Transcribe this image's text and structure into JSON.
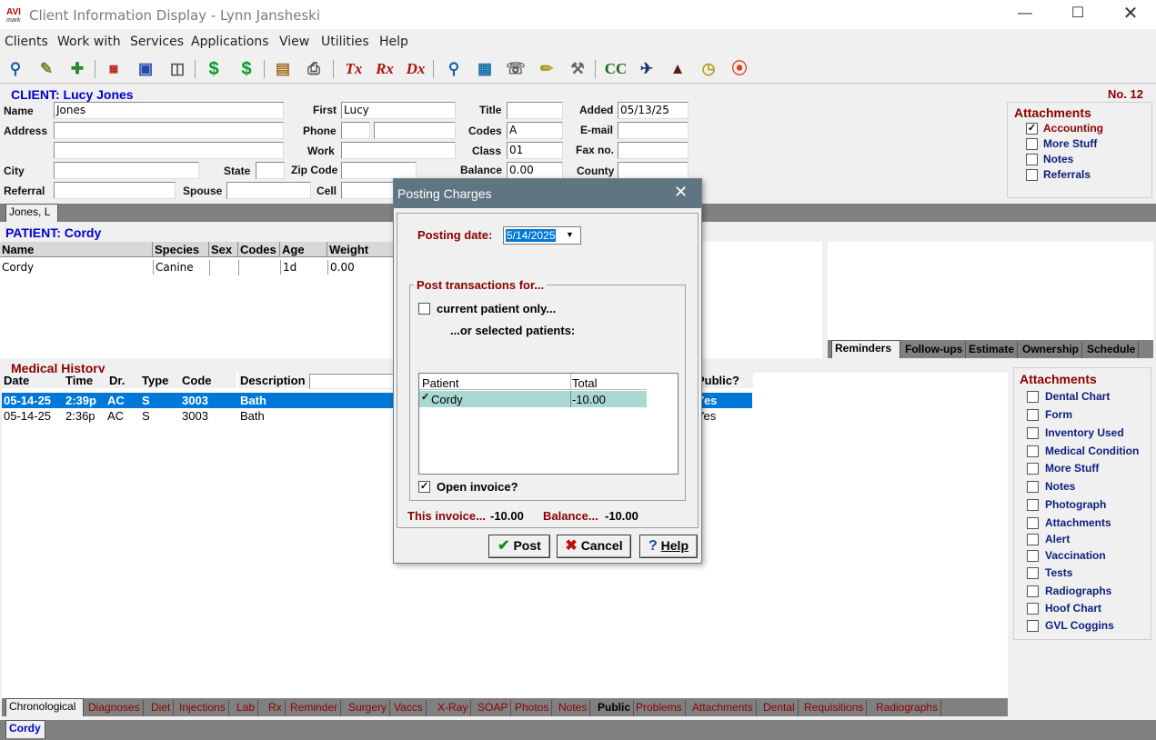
{
  "window": {
    "title": "Client Information Display - Lynn Jansheski",
    "logo_text": "AVImark"
  },
  "menu": [
    "Clients",
    "Work with",
    "Services",
    "Applications",
    "View",
    "Utilities",
    "Help"
  ],
  "toolbar_icons": [
    "search-icon",
    "edit-icon",
    "new-document-icon",
    "calendar-icon",
    "box-icon",
    "monitor-icon",
    "dollar-icon",
    "dollar-plus-icon",
    "clipboard-icon",
    "printer-icon",
    "tx-icon",
    "rx-icon",
    "dx-icon",
    "magnifier-icon",
    "calculator-icon",
    "phone-icon",
    "pencil-icon",
    "wrench-icon",
    "cc-icon",
    "airplane-icon",
    "graduation-cap-icon",
    "timer-icon",
    "lifebuoy-icon"
  ],
  "client": {
    "header": "CLIENT:  Lucy Jones",
    "number": "No. 12",
    "labels": {
      "name": "Name",
      "address": "Address",
      "city": "City",
      "state": "State",
      "zip": "Zip Code",
      "referral": "Referral",
      "spouse": "Spouse",
      "first": "First",
      "phone": "Phone",
      "work": "Work",
      "cell": "Cell",
      "title": "Title",
      "codes": "Codes",
      "class": "Class",
      "balance": "Balance",
      "added": "Added",
      "email": "E-mail",
      "fax": "Fax no.",
      "county": "County"
    },
    "values": {
      "name": "Jones",
      "first": "Lucy",
      "codes": "A",
      "class": "01",
      "balance": "0.00",
      "added": "05/13/25"
    },
    "tab": "Jones, L"
  },
  "client_attachments": {
    "title": "Attachments",
    "items": [
      {
        "label": "Accounting",
        "checked": true
      },
      {
        "label": "More Stuff",
        "checked": false
      },
      {
        "label": "Notes",
        "checked": false
      },
      {
        "label": "Referrals",
        "checked": false
      }
    ]
  },
  "patient": {
    "header": "PATIENT:  Cordy",
    "columns": [
      "Name",
      "Species",
      "Sex",
      "Codes",
      "Age",
      "Weight"
    ],
    "rows": [
      [
        "Cordy",
        "Canine",
        "",
        "",
        "1d",
        "0.00"
      ]
    ],
    "tab": "Cordy"
  },
  "patient_tabs": [
    "Reminders",
    "Follow-ups",
    "Estimate",
    "Ownership",
    "Schedule"
  ],
  "medical_history": {
    "title": "Medical History",
    "columns": [
      "Date",
      "Time",
      "Dr.",
      "Type",
      "Code",
      "Description",
      "Public?"
    ],
    "rows": [
      {
        "date": "05-14-25",
        "time": "2:39p",
        "dr": "AC",
        "type": "S",
        "code": "3003",
        "desc": "Bath",
        "public": "Yes"
      },
      {
        "date": "05-14-25",
        "time": "2:36p",
        "dr": "AC",
        "type": "S",
        "code": "3003",
        "desc": "Bath",
        "public": "Yes"
      }
    ]
  },
  "mh_attachments": {
    "title": "Attachments",
    "items": [
      "Dental Chart",
      "Form",
      "Inventory Used",
      "Medical Condition",
      "More Stuff",
      "Notes",
      "Photograph",
      "Attachments",
      "Alert",
      "Vaccination",
      "Tests",
      "Radiographs",
      "Hoof Chart",
      "GVL Coggins"
    ]
  },
  "bottom_tabs": [
    "Chronological",
    "Diagnoses",
    "Diet",
    "Injections",
    "Lab",
    "Rx",
    "Reminder",
    "Surgery",
    "Vaccs",
    "X-Ray",
    "SOAP",
    "Photos",
    "Notes",
    "Public",
    "Problems",
    "Attachments",
    "Dental",
    "Requisitions",
    "Radiographs"
  ],
  "dialog": {
    "title": "Posting Charges",
    "posting_date_label": "Posting date:",
    "posting_date": "5/14/2025",
    "group_label": "Post transactions for...",
    "current_only": "current patient only...",
    "selected": "...or selected patients:",
    "grid_cols": [
      "Patient",
      "Total"
    ],
    "grid_rows": [
      {
        "patient": "Cordy",
        "total": "-10.00",
        "checked": true
      }
    ],
    "open_invoice": "Open invoice?",
    "open_invoice_checked": true,
    "invoice_label": "This invoice...",
    "invoice_value": "-10.00",
    "balance_label": "Balance...",
    "balance_value": "-10.00",
    "post": "Post",
    "cancel": "Cancel",
    "help": "Help"
  }
}
